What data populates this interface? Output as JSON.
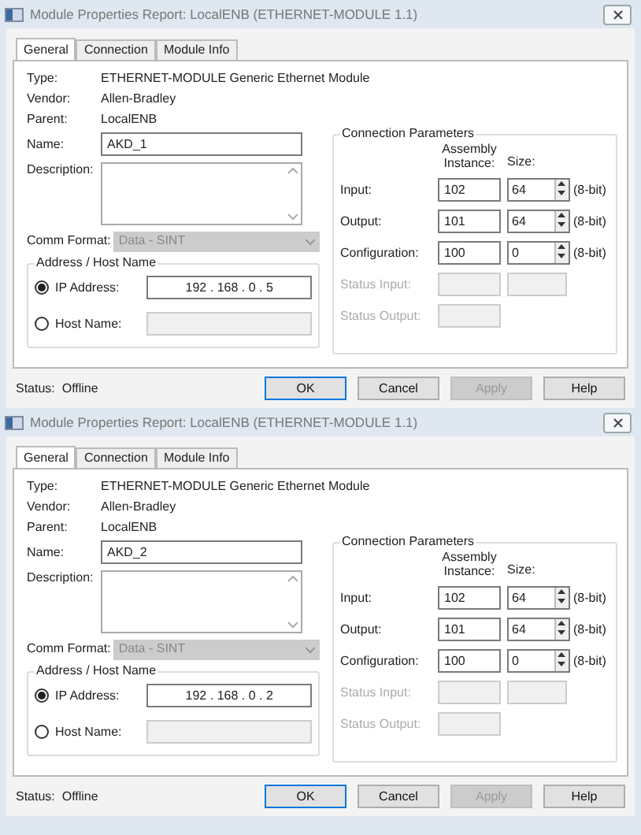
{
  "dialogs": [
    {
      "title": "Module Properties Report: LocalENB (ETHERNET-MODULE 1.1)",
      "tabs": [
        {
          "label": "General",
          "selected": true
        },
        {
          "label": "Connection",
          "selected": false
        },
        {
          "label": "Module Info",
          "selected": false
        }
      ],
      "info": [
        {
          "label": "Type:",
          "value": "ETHERNET-MODULE Generic Ethernet Module"
        },
        {
          "label": "Vendor:",
          "value": "Allen-Bradley"
        },
        {
          "label": "Parent:",
          "value": "LocalENB"
        }
      ],
      "name": {
        "label": "Name:",
        "value": "AKD_1"
      },
      "description": {
        "label": "Description:"
      },
      "comm_format": {
        "label": "Comm Format:",
        "value": "Data - SINT",
        "disabled": true
      },
      "address": {
        "title": "Address / Host Name",
        "ip": {
          "label": "IP Address:",
          "selected": true,
          "octets": [
            "192",
            "168",
            "0",
            "5"
          ],
          "separator": "."
        },
        "host": {
          "label": "Host Name:",
          "selected": false
        }
      },
      "connection": {
        "title": "Connection Parameters",
        "instance_header": "Assembly Instance:",
        "size_header": "Size:",
        "rows": [
          {
            "kind": "param",
            "label": "Input:",
            "instance": "102",
            "size": "64",
            "unit": "(8-bit)",
            "disabled": false
          },
          {
            "kind": "param",
            "label": "Output:",
            "instance": "101",
            "size": "64",
            "unit": "(8-bit)",
            "disabled": false
          },
          {
            "kind": "param",
            "label": "Configuration:",
            "instance": "100",
            "size": "0",
            "unit": "(8-bit)",
            "disabled": false
          },
          {
            "kind": "status-pair",
            "label": "Status Input:",
            "disabled": true
          },
          {
            "kind": "status-single",
            "label": "Status Output:",
            "disabled": true
          }
        ]
      },
      "status": {
        "label": "Status:",
        "value": "Offline"
      },
      "buttons": [
        {
          "label": "OK",
          "default": true,
          "disabled": false
        },
        {
          "label": "Cancel",
          "default": false,
          "disabled": false
        },
        {
          "label": "Apply",
          "default": false,
          "disabled": true
        },
        {
          "label": "Help",
          "default": false,
          "disabled": false
        }
      ]
    },
    {
      "title": "Module Properties Report: LocalENB (ETHERNET-MODULE 1.1)",
      "tabs": [
        {
          "label": "General",
          "selected": true
        },
        {
          "label": "Connection",
          "selected": false
        },
        {
          "label": "Module Info",
          "selected": false
        }
      ],
      "info": [
        {
          "label": "Type:",
          "value": "ETHERNET-MODULE Generic Ethernet Module"
        },
        {
          "label": "Vendor:",
          "value": "Allen-Bradley"
        },
        {
          "label": "Parent:",
          "value": "LocalENB"
        }
      ],
      "name": {
        "label": "Name:",
        "value": "AKD_2"
      },
      "description": {
        "label": "Description:"
      },
      "comm_format": {
        "label": "Comm Format:",
        "value": "Data - SINT",
        "disabled": true
      },
      "address": {
        "title": "Address / Host Name",
        "ip": {
          "label": "IP Address:",
          "selected": true,
          "octets": [
            "192",
            "168",
            "0",
            "2"
          ],
          "separator": "."
        },
        "host": {
          "label": "Host Name:",
          "selected": false
        }
      },
      "connection": {
        "title": "Connection Parameters",
        "instance_header": "Assembly Instance:",
        "size_header": "Size:",
        "rows": [
          {
            "kind": "param",
            "label": "Input:",
            "instance": "102",
            "size": "64",
            "unit": "(8-bit)",
            "disabled": false
          },
          {
            "kind": "param",
            "label": "Output:",
            "instance": "101",
            "size": "64",
            "unit": "(8-bit)",
            "disabled": false
          },
          {
            "kind": "param",
            "label": "Configuration:",
            "instance": "100",
            "size": "0",
            "unit": "(8-bit)",
            "disabled": false
          },
          {
            "kind": "status-pair",
            "label": "Status Input:",
            "disabled": true
          },
          {
            "kind": "status-single",
            "label": "Status Output:",
            "disabled": true
          }
        ]
      },
      "status": {
        "label": "Status:",
        "value": "Offline"
      },
      "buttons": [
        {
          "label": "OK",
          "default": true,
          "disabled": false
        },
        {
          "label": "Cancel",
          "default": false,
          "disabled": false
        },
        {
          "label": "Apply",
          "default": false,
          "disabled": true
        },
        {
          "label": "Help",
          "default": false,
          "disabled": false
        }
      ]
    }
  ]
}
